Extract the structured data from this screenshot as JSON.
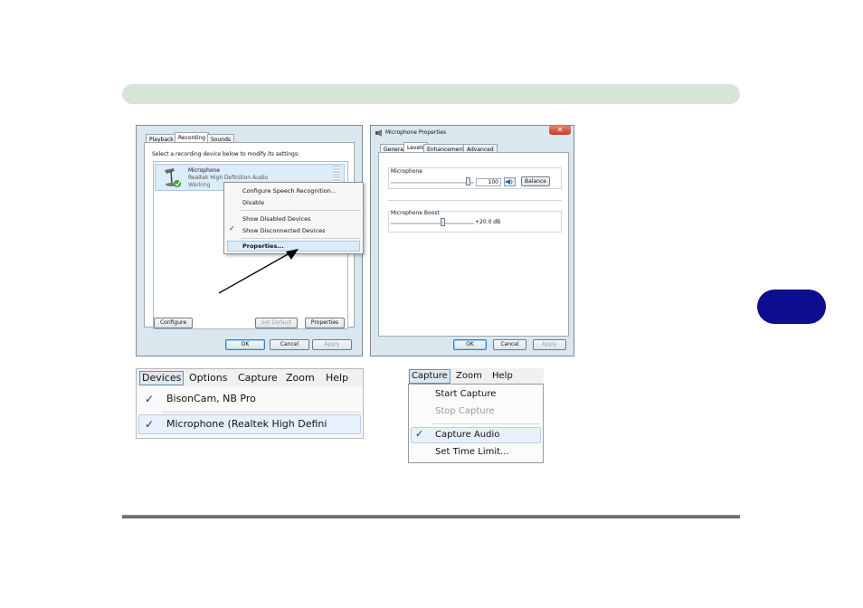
{
  "recording_dialog": {
    "tabs": [
      "Playback",
      "Recording",
      "Sounds"
    ],
    "instruction": "Select a recording device below to modify its settings:",
    "device": {
      "name": "Microphone",
      "description": "Realtek High Definition Audio",
      "status": "Working"
    },
    "context_menu": [
      "Configure Speech Recognition...",
      "Disable",
      "Show Disabled Devices",
      "Show Disconnected Devices",
      "Properties..."
    ],
    "buttons": {
      "configure": "Configure",
      "set_default": "Set Default",
      "properties": "Properties",
      "ok": "OK",
      "cancel": "Cancel",
      "apply": "Apply"
    }
  },
  "properties_dialog": {
    "title": "Microphone Properties",
    "tabs": [
      "General",
      "Levels",
      "Enhancements",
      "Advanced"
    ],
    "microphone": {
      "label": "Microphone",
      "value": "100",
      "balance": "Balance"
    },
    "boost": {
      "label": "Microphone Boost",
      "value": "+20.0 dB"
    },
    "buttons": {
      "ok": "OK",
      "cancel": "Cancel",
      "apply": "Apply"
    }
  },
  "devices_menu": {
    "menubar": [
      "Devices",
      "Options",
      "Capture",
      "Zoom",
      "Help"
    ],
    "items": [
      "BisonCam, NB Pro",
      "Microphone (Realtek High Defini"
    ]
  },
  "capture_menu": {
    "menubar": [
      "Capture",
      "Zoom",
      "Help"
    ],
    "items": [
      "Start Capture",
      "Stop Capture",
      "Capture Audio",
      "Set Time Limit..."
    ]
  },
  "colors": {
    "header_bar": "#d6e6d6",
    "chapter_tab": "#0d0d8f",
    "footer_rule": "#6f6f6f"
  }
}
